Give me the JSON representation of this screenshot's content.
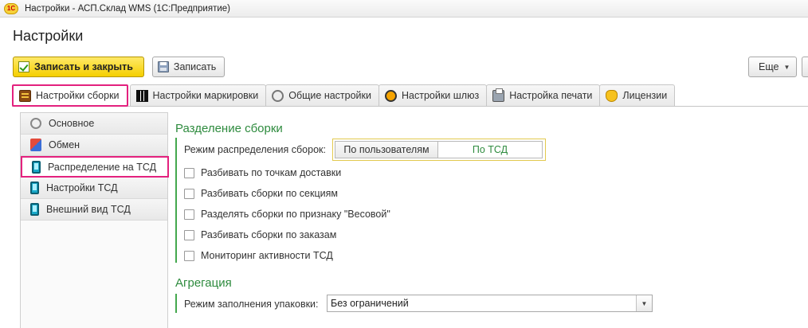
{
  "window": {
    "title": "Настройки - АСП.Склад WMS  (1С:Предприятие)",
    "logo": "1С"
  },
  "page": {
    "title": "Настройки"
  },
  "toolbar": {
    "save_close_label": "Записать и закрыть",
    "save_label": "Записать",
    "more_label": "Еще",
    "help_label": "?"
  },
  "tabs": [
    {
      "label": "Настройки сборки",
      "icon": "assembly-settings-icon",
      "active": true
    },
    {
      "label": "Настройки маркировки",
      "icon": "qr-code-icon"
    },
    {
      "label": "Общие настройки",
      "icon": "gear-icon"
    },
    {
      "label": "Настройки шлюз",
      "icon": "gateway-icon"
    },
    {
      "label": "Настройка печати",
      "icon": "printer-icon"
    },
    {
      "label": "Лицензии",
      "icon": "license-icon"
    }
  ],
  "sidebar": {
    "items": [
      {
        "label": "Основное",
        "icon": "gear-icon"
      },
      {
        "label": "Обмен",
        "icon": "exchange-icon"
      },
      {
        "label": "Распределение на ТСД",
        "icon": "handheld-device-icon",
        "active": true
      },
      {
        "label": "Настройки ТСД",
        "icon": "handheld-device-icon"
      },
      {
        "label": "Внешний вид ТСД",
        "icon": "handheld-device-icon"
      }
    ]
  },
  "assembly_split": {
    "title": "Разделение сборки",
    "mode_label": "Режим распределения сборок:",
    "mode_options": [
      "По пользователям",
      "По ТСД"
    ],
    "mode_selected": "По ТСД",
    "checkboxes": [
      {
        "label": "Разбивать по точкам доставки",
        "checked": false
      },
      {
        "label": "Разбивать сборки по секциям",
        "checked": false
      },
      {
        "label": "Разделять сборки по признаку \"Весовой\"",
        "checked": false
      },
      {
        "label": "Разбивать сборки по заказам",
        "checked": false
      },
      {
        "label": "Мониторинг активности ТСД",
        "checked": false
      }
    ]
  },
  "aggregation": {
    "title": "Агрегация",
    "fill_label": "Режим заполнения упаковки:",
    "fill_value": "Без ограничений"
  },
  "colors": {
    "accent_green": "#2e8b3e",
    "highlight": "#e3217e",
    "primary_button": "#f5cf00"
  }
}
